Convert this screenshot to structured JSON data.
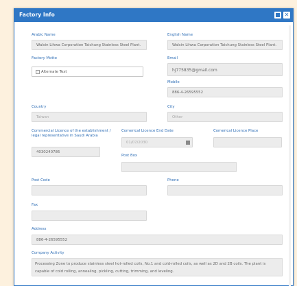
{
  "dialog": {
    "title": "Factory Info"
  },
  "fields": {
    "arabic_name": {
      "label": "Arabic Name",
      "value": "Walsin Lihwa Corporation  Taichung Stainless Steel Plant."
    },
    "english_name": {
      "label": "English Name",
      "value": "Walsin Lihwa Corporation  Taichung Stainless Steel Plant."
    },
    "factory_motto": {
      "label": "Factory Motto",
      "value": "Alternate Text"
    },
    "email": {
      "label": "Email",
      "value": "hj775835@gmail.com"
    },
    "mobile": {
      "label": "Mobile",
      "value": "886-4-26595552"
    },
    "country": {
      "label": "Country",
      "value": "Taiwan"
    },
    "city": {
      "label": "City",
      "value": "Other"
    },
    "commercial_licence": {
      "label": "Commercial Licence of the establishment / legal representative in Saudi Arabia",
      "value": "4030240786"
    },
    "licence_end_date": {
      "label": "Comerical Licence End Date",
      "value": "01/07/2030"
    },
    "licence_place": {
      "label": "Comerical Licence Place",
      "value": ""
    },
    "post_box": {
      "label": "Post Box",
      "value": ""
    },
    "post_code": {
      "label": "Post Code",
      "value": ""
    },
    "phone": {
      "label": "Phone",
      "value": ""
    },
    "fax": {
      "label": "Fax",
      "value": ""
    },
    "address": {
      "label": "Address",
      "value": "886-4-26595552"
    },
    "company_activity": {
      "label": "Company Activity",
      "value": "Processing Zone to produce stainless steel hot-rolled coils, No.1 and cold-rolled coils, as well as 2D and 2B coils. The plant is capable of cold rolling, annealing, pickling, cutting, trimming, and leveling."
    }
  },
  "icons": {
    "maximize": "maximize-icon",
    "close": "close-icon",
    "calendar": "calendar-icon",
    "image": "broken-image-icon"
  },
  "colors": {
    "accent": "#2f77c5",
    "label": "#2d6db5",
    "field_bg": "#ececec",
    "backdrop": "#fdf1de"
  }
}
